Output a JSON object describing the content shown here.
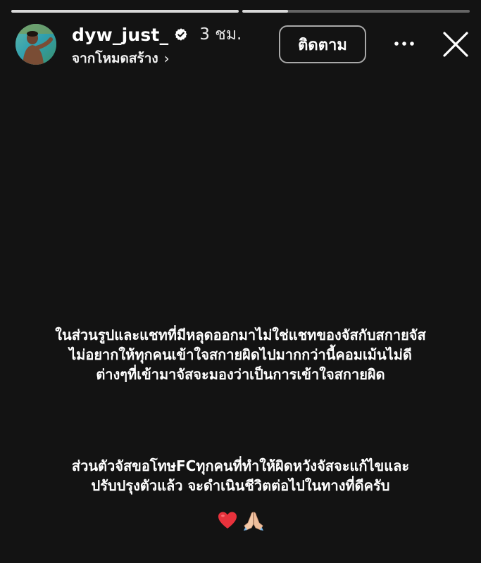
{
  "story": {
    "progress": [
      1.0,
      0.2
    ],
    "username": "dyw_just_",
    "verified": true,
    "time_ago": "3 ชม.",
    "subtitle": "จากโหมดสร้าง",
    "follow_label": "ติดตาม"
  },
  "content": {
    "paragraph1": [
      "ในส่วนรูปและแชทที่มีหลุดออกมาไม่ใช่แชทของจัสกับสกายจัส",
      "ไม่อยากให้ทุกคนเข้าใจสกายผิดไปมากกว่านี้คอมเม้นไม่ดี",
      "ต่างๆที่เข้ามาจัสจะมองว่าเป็นการเข้าใจสกายผิด"
    ],
    "paragraph2": [
      "ส่วนตัวจัสขอโทษFCทุกคนที่ทำให้ผิดหวังจัสจะแก้ไขและ",
      "ปรับปรุงตัวแล้ว จะดำเนินชีวิตต่อไปในทางที่ดีครับ"
    ],
    "emojis": [
      "heart-icon",
      "praying-hands-icon"
    ]
  },
  "colors": {
    "background": "#131313",
    "text": "#ffffff",
    "heart": "#e8323c"
  }
}
